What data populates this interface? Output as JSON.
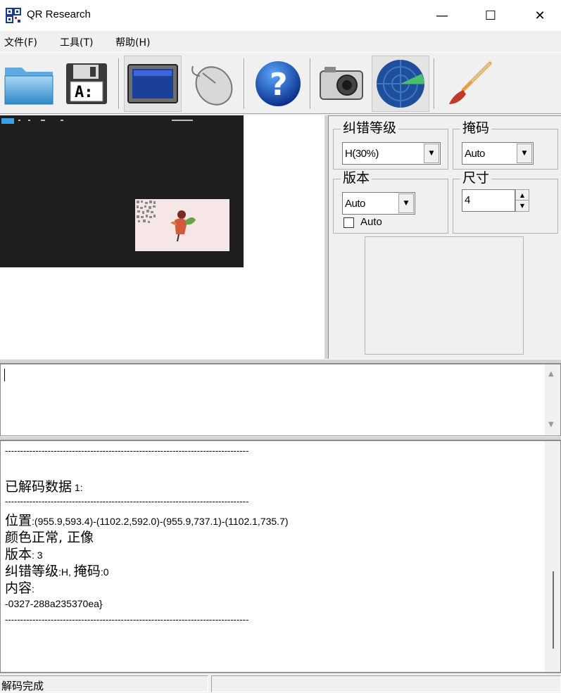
{
  "window": {
    "title": "QR Research",
    "minimize_glyph": "—",
    "maximize_glyph": "☐",
    "close_glyph": "✕"
  },
  "menu": [
    {
      "label": "文件(F)"
    },
    {
      "label": "工具(T)"
    },
    {
      "label": "帮助(H)"
    }
  ],
  "toolbar": {
    "buttons": [
      {
        "icon": "open-folder-icon"
      },
      {
        "icon": "save-disk-icon"
      },
      {
        "icon": "monitor-icon",
        "pressed": true
      },
      {
        "icon": "mouse-icon"
      },
      {
        "icon": "help-icon"
      },
      {
        "icon": "camera-icon"
      },
      {
        "icon": "radar-icon"
      },
      {
        "icon": "paintbrush-icon"
      }
    ]
  },
  "settings": {
    "ec_level": {
      "label": "纠错等级",
      "value": "H(30%)"
    },
    "mask": {
      "label": "掩码",
      "value": "Auto"
    },
    "version": {
      "label": "版本",
      "value": "Auto",
      "checkbox_label": "Auto",
      "checked": false
    },
    "size": {
      "label": "尺寸",
      "value": "4"
    }
  },
  "input": {
    "text": ""
  },
  "output": {
    "separator": "--------------------------------------------------------------------------------",
    "decoded_header_cn": "已解码数据",
    "decoded_header_num": " 1:",
    "position_label": "位置",
    "position_value": ":(955.9,593.4)-(1102.2,592.0)-(955.9,737.1)-(1102.1,735.7)",
    "color_line": "颜色正常, 正像",
    "version_label": "版本",
    "version_value": ": 3",
    "ec_label": "纠错等级",
    "ec_value": ":H, ",
    "mask_label": "掩码",
    "mask_value": ":0",
    "content_label": "内容",
    "content_colon": ":",
    "content_value": "-0327-288a235370ea}"
  },
  "status": {
    "text": "解码完成"
  },
  "colors": {
    "accent_blue": "#3aa0e8",
    "preview_dark": "#1e1e1e",
    "card_pink": "#f7e6e6"
  }
}
